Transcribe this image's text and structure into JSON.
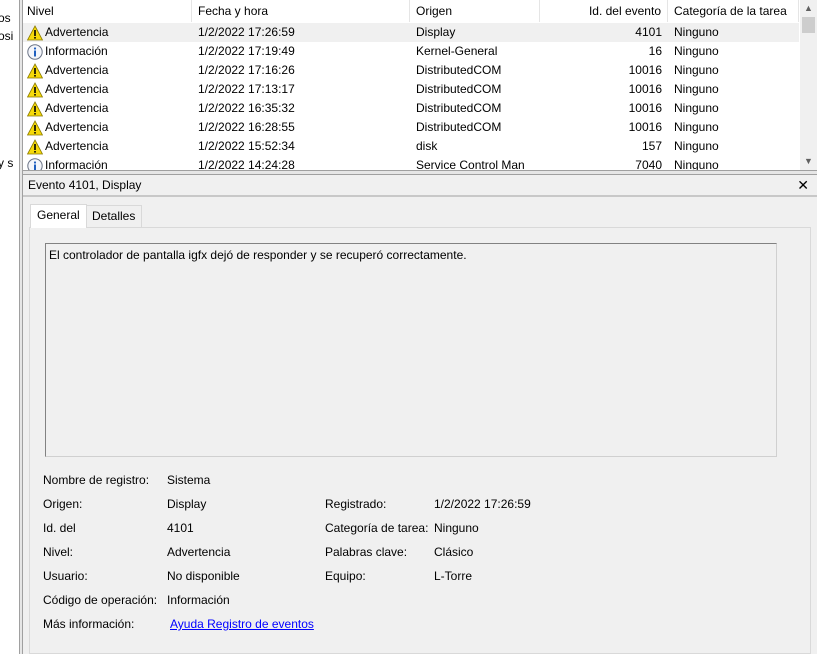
{
  "sidebar": {
    "fragments": [
      "os",
      "osi",
      "y s"
    ]
  },
  "table": {
    "columns": [
      "Nivel",
      "Fecha y hora",
      "Origen",
      "Id. del evento",
      "Categoría de la tarea"
    ],
    "rows": [
      {
        "level": "Advertencia",
        "icon": "warning",
        "date": "1/2/2022 17:26:59",
        "source": "Display",
        "id": "4101",
        "category": "Ninguno"
      },
      {
        "level": "Información",
        "icon": "info",
        "date": "1/2/2022 17:19:49",
        "source": "Kernel-General",
        "id": "16",
        "category": "Ninguno"
      },
      {
        "level": "Advertencia",
        "icon": "warning",
        "date": "1/2/2022 17:16:26",
        "source": "DistributedCOM",
        "id": "10016",
        "category": "Ninguno"
      },
      {
        "level": "Advertencia",
        "icon": "warning",
        "date": "1/2/2022 17:13:17",
        "source": "DistributedCOM",
        "id": "10016",
        "category": "Ninguno"
      },
      {
        "level": "Advertencia",
        "icon": "warning",
        "date": "1/2/2022 16:35:32",
        "source": "DistributedCOM",
        "id": "10016",
        "category": "Ninguno"
      },
      {
        "level": "Advertencia",
        "icon": "warning",
        "date": "1/2/2022 16:28:55",
        "source": "DistributedCOM",
        "id": "10016",
        "category": "Ninguno"
      },
      {
        "level": "Advertencia",
        "icon": "warning",
        "date": "1/2/2022 15:52:34",
        "source": "disk",
        "id": "157",
        "category": "Ninguno"
      },
      {
        "level": "Información",
        "icon": "info",
        "date": "1/2/2022 14:24:28",
        "source": "Service Control Man",
        "id": "7040",
        "category": "Ninguno"
      }
    ]
  },
  "details": {
    "title": "Evento 4101, Display",
    "close": "✕",
    "tabs": [
      "General",
      "Detalles"
    ],
    "message": "El controlador de pantalla igfx dejó de responder y se recuperó correctamente.",
    "fields": {
      "log_name_label": "Nombre de registro:",
      "log_name": "Sistema",
      "source_label": "Origen:",
      "source": "Display",
      "logged_label": "Registrado:",
      "logged": "1/2/2022 17:26:59",
      "id_label": "Id. del",
      "id": "4101",
      "task_label": "Categoría de tarea:",
      "task": "Ninguno",
      "level_label": "Nivel:",
      "level": "Advertencia",
      "keywords_label": "Palabras clave:",
      "keywords": "Clásico",
      "user_label": "Usuario:",
      "user": "No disponible",
      "computer_label": "Equipo:",
      "computer": "L-Torre",
      "opcode_label": "Código de operación:",
      "opcode": "Información",
      "more_label": "Más información:",
      "more_link": "Ayuda Registro de eventos"
    }
  }
}
